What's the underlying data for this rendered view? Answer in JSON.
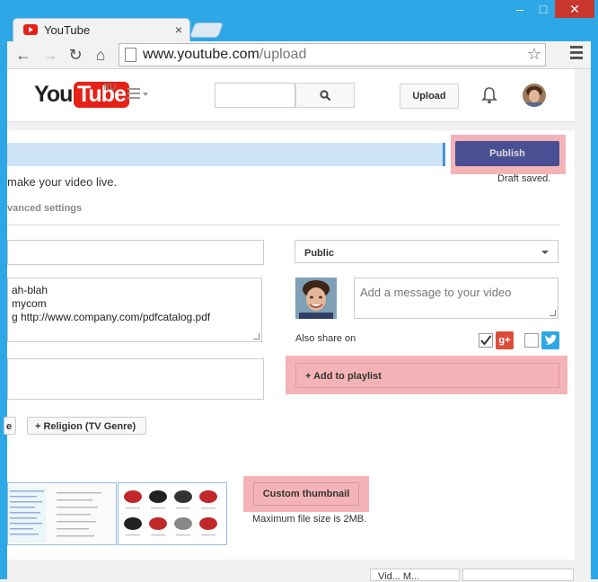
{
  "browser": {
    "tab_title": "YouTube",
    "tab_close": "×",
    "url_host": "www.youtube.com",
    "url_path": "/upload",
    "win_min": "–",
    "win_max": "□",
    "win_close": "✕",
    "back": "←",
    "forward": "→",
    "reload": "↻",
    "home": "⌂",
    "star": "☆"
  },
  "header": {
    "logo_you": "You",
    "logo_tube": "Tube",
    "region": "RU",
    "upload_label": "Upload",
    "search_placeholder": ""
  },
  "upload": {
    "publish_label": "Publish",
    "draft_status": "Draft saved.",
    "live_text": "make your video live.",
    "advanced_tab": "vanced settings",
    "privacy_value": "Public",
    "description_lines": [
      "ah-blah",
      "mycom",
      "g http://www.company.com/pdfcatalog.pdf"
    ],
    "message_placeholder": "Add a message to your video",
    "also_share": "Also share on",
    "gplus_label": "g+",
    "add_playlist": "+ Add to playlist",
    "chip_partial": "e",
    "chip_religion": "+ Religion (TV Genre)",
    "custom_thumbnail": "Custom thumbnail",
    "max_file_size": "Maximum file size is 2MB.",
    "bottom_tab": "Vid... M..."
  },
  "colors": {
    "window_frame": "#2ea7e6",
    "publish_button": "#4a4f93",
    "highlight": "#f4b4b7",
    "yt_red": "#e62117"
  }
}
